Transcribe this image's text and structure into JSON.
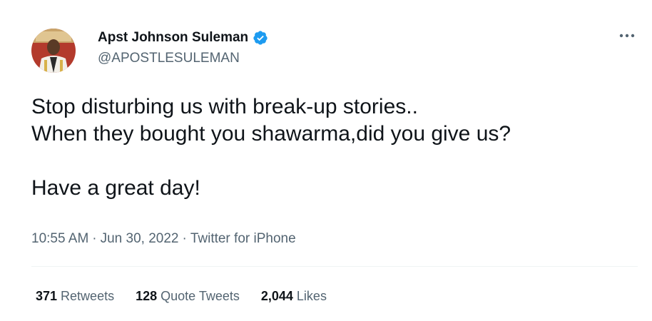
{
  "author": {
    "display_name": "Apst Johnson Suleman",
    "handle": "@APOSTLESULEMAN",
    "verified": true,
    "verified_color": "#1d9bf0"
  },
  "tweet": {
    "lines": [
      "Stop disturbing us with break-up stories..",
      "When they bought you shawarma,did you give us?",
      "",
      "Have a great day!"
    ]
  },
  "meta": {
    "time": "10:55 AM",
    "date": "Jun 30, 2022",
    "source": "Twitter for iPhone",
    "separator": "·"
  },
  "stats": [
    {
      "count": "371",
      "label": "Retweets"
    },
    {
      "count": "128",
      "label": "Quote Tweets"
    },
    {
      "count": "2,044",
      "label": "Likes"
    }
  ],
  "icons": {
    "more": "more-horizontal-icon",
    "verified": "verified-badge-icon"
  },
  "colors": {
    "text_primary": "#0f1419",
    "text_secondary": "#536471",
    "divider": "#eff3f4"
  }
}
